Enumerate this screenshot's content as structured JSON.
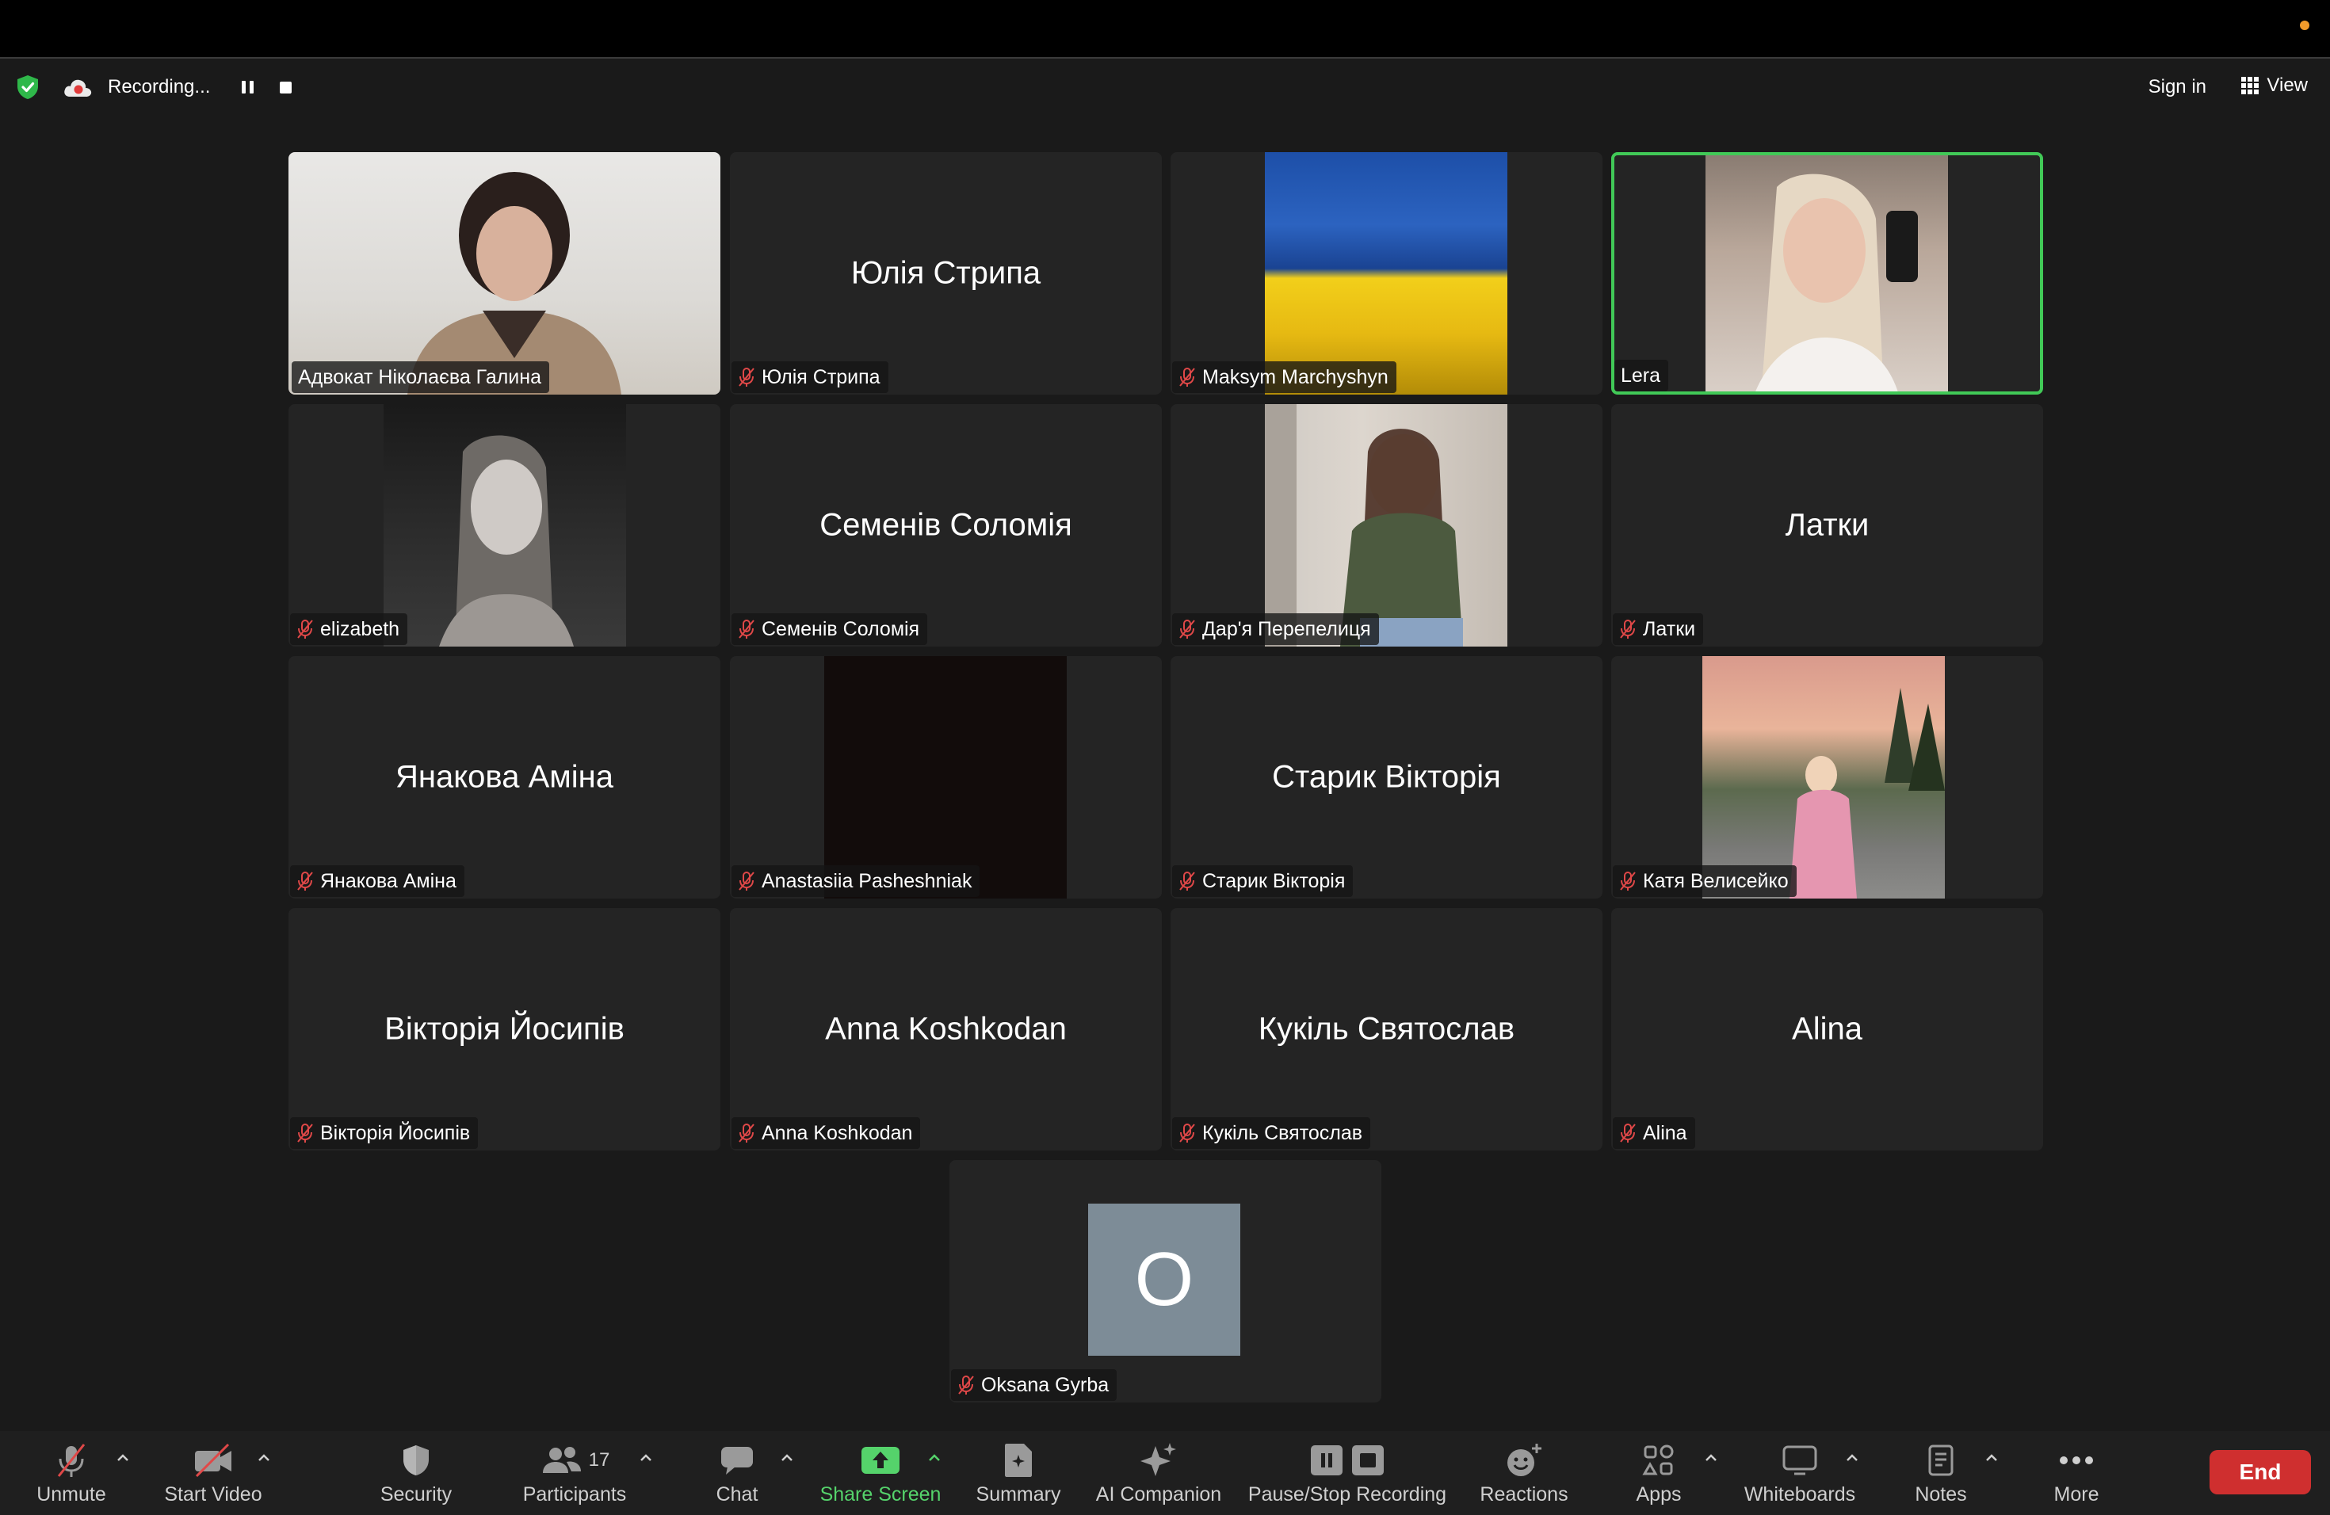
{
  "topbar": {
    "recording_label": "Recording...",
    "signin_label": "Sign in",
    "view_label": "View"
  },
  "tiles": [
    {
      "name": "Адвокат Ніколаєва Галина",
      "center": "",
      "muted": false,
      "has_video": true
    },
    {
      "name": "Юлія Стрипа",
      "center": "Юлія Стрипа",
      "muted": true,
      "has_video": false
    },
    {
      "name": "Maksym Marchyshyn",
      "center": "",
      "muted": true,
      "has_video": true
    },
    {
      "name": "Lera",
      "center": "",
      "muted": false,
      "has_video": true,
      "active_speaker": true
    },
    {
      "name": "elizabeth",
      "center": "",
      "muted": true,
      "has_video": true
    },
    {
      "name": "Семенів Соломія",
      "center": "Семенів Соломія",
      "muted": true,
      "has_video": false
    },
    {
      "name": "Дар'я Перепелиця",
      "center": "",
      "muted": true,
      "has_video": true
    },
    {
      "name": "Латки",
      "center": "Латки",
      "muted": true,
      "has_video": false
    },
    {
      "name": "Янакова Аміна",
      "center": "Янакова Аміна",
      "muted": true,
      "has_video": false
    },
    {
      "name": "Anastasiia Pasheshniak",
      "center": "",
      "muted": true,
      "has_video": true
    },
    {
      "name": "Старик Вікторія",
      "center": "Старик Вікторія",
      "muted": true,
      "has_video": false
    },
    {
      "name": "Катя Велисейко",
      "center": "",
      "muted": true,
      "has_video": true
    },
    {
      "name": "Вікторія Йосипів",
      "center": "Вікторія Йосипів",
      "muted": true,
      "has_video": false
    },
    {
      "name": "Anna Koshkodan",
      "center": "Anna Koshkodan",
      "muted": true,
      "has_video": false
    },
    {
      "name": "Кукіль Святослав",
      "center": "Кукіль Святослав",
      "muted": true,
      "has_video": false
    },
    {
      "name": "Alina",
      "center": "Alina",
      "muted": true,
      "has_video": false
    },
    {
      "name": "Oksana Gyrba",
      "center": "",
      "muted": true,
      "has_video": false,
      "avatar_letter": "O"
    }
  ],
  "toolbar": {
    "unmute": "Unmute",
    "start_video": "Start Video",
    "security": "Security",
    "participants": "Participants",
    "participants_count": "17",
    "chat": "Chat",
    "share_screen": "Share Screen",
    "summary": "Summary",
    "ai_companion": "AI Companion",
    "pause_stop_recording": "Pause/Stop Recording",
    "reactions": "Reactions",
    "apps": "Apps",
    "whiteboards": "Whiteboards",
    "notes": "Notes",
    "more": "More",
    "end": "End"
  },
  "colors": {
    "active_speaker_border": "#41c957",
    "share_screen_green": "#55d36b",
    "muted_red": "#e04848",
    "end_button": "#cf2f2f",
    "recording_dot": "#f09a2b"
  }
}
